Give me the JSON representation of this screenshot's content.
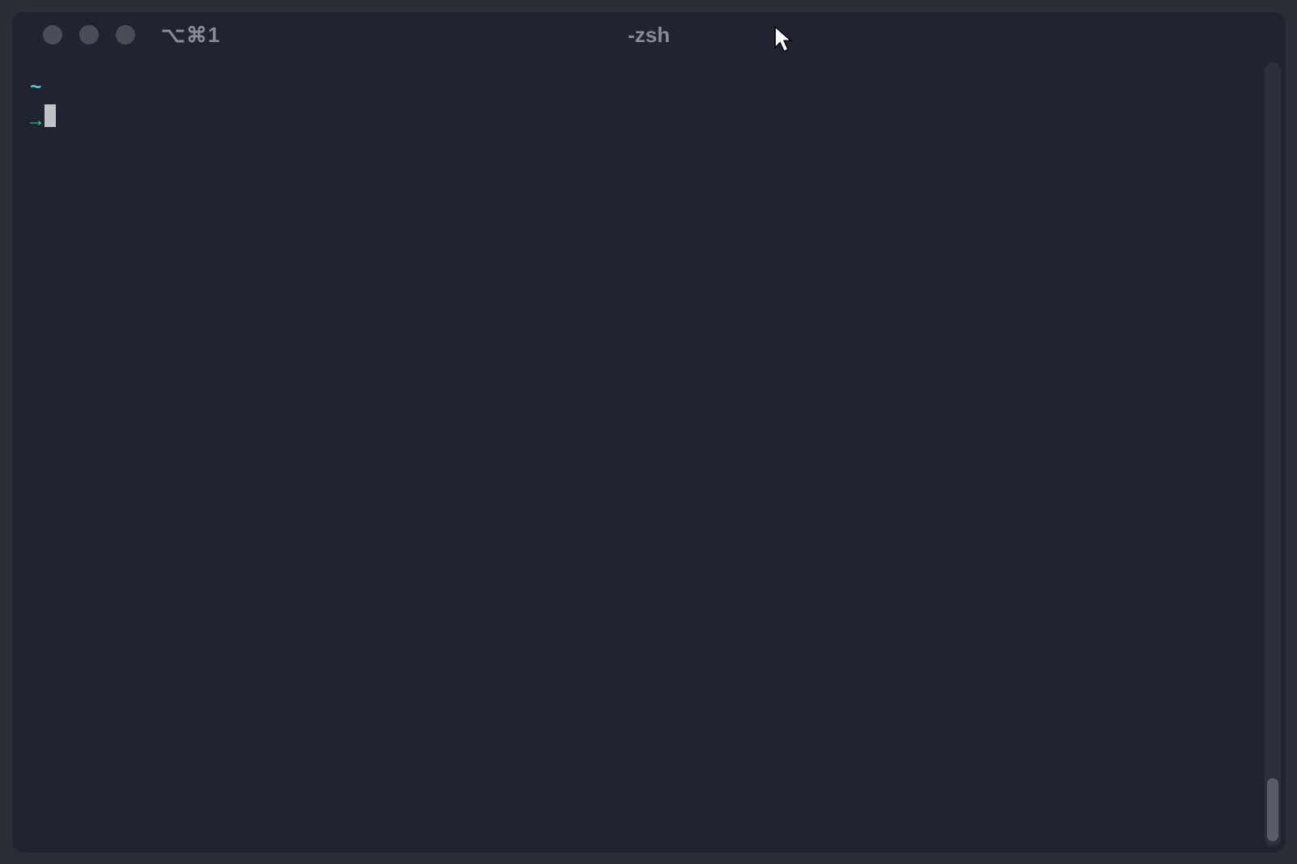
{
  "window": {
    "title": "-zsh",
    "hotkey_label": "⌥⌘1"
  },
  "prompt": {
    "cwd": "~",
    "arrow": "→",
    "input": ""
  },
  "colors": {
    "bg": "#1f2430",
    "outer_bg": "#2a2d35",
    "traffic_light": "#4b4d56",
    "title_text": "#888a94",
    "cwd": "#5ac8e0",
    "arrow": "#3ad07f",
    "cursor": "#c0c2c8"
  }
}
